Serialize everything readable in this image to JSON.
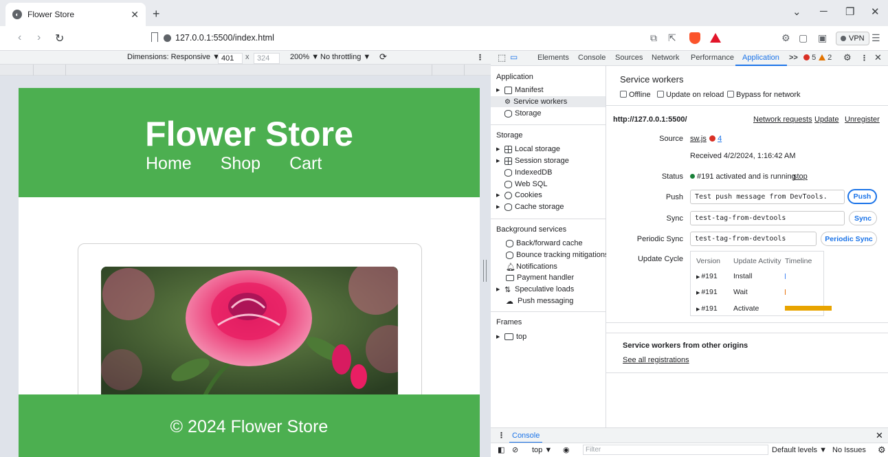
{
  "browser": {
    "tab_title": "Flower Store",
    "url": "127.0.0.1:5500/index.html",
    "vpn_label": "VPN"
  },
  "device_toolbar": {
    "dimensions_label": "Dimensions: Responsive ▼",
    "width": "401",
    "times": "x",
    "height": "324",
    "zoom": "200% ▼",
    "throttling": "No throttling ▼"
  },
  "site": {
    "title": "Flower Store",
    "nav": [
      "Home",
      "Shop",
      "Cart"
    ],
    "footer": "© 2024 Flower Store",
    "brand_color": "#4caf50"
  },
  "devtools": {
    "tabs": [
      "Elements",
      "Console",
      "Sources",
      "Network",
      "Performance",
      "Application",
      ">>"
    ],
    "active_tab": "Application",
    "error_count": "5",
    "warning_count": "2",
    "sidebar": {
      "application_header": "Application",
      "application_items": [
        "Manifest",
        "Service workers",
        "Storage"
      ],
      "storage_header": "Storage",
      "storage_items": [
        "Local storage",
        "Session storage",
        "IndexedDB",
        "Web SQL",
        "Cookies",
        "Cache storage"
      ],
      "background_header": "Background services",
      "background_items": [
        "Back/forward cache",
        "Bounce tracking mitigations",
        "Notifications",
        "Payment handler",
        "Speculative loads",
        "Push messaging"
      ],
      "frames_header": "Frames",
      "frames_items": [
        "top"
      ]
    },
    "service_workers": {
      "heading": "Service workers",
      "options": [
        "Offline",
        "Update on reload",
        "Bypass for network"
      ],
      "origin": "http://127.0.0.1:5500/",
      "links": [
        "Network requests",
        "Update",
        "Unregister"
      ],
      "source_label": "Source",
      "source_file": "sw.js",
      "source_errors": "4",
      "received": "Received 4/2/2024, 1:16:42 AM",
      "status_label": "Status",
      "status_text": "#191 activated and is running",
      "status_stop": "stop",
      "push_label": "Push",
      "push_value": "Test push message from DevTools.",
      "push_button": "Push",
      "sync_label": "Sync",
      "sync_value": "test-tag-from-devtools",
      "sync_button": "Sync",
      "periodic_label": "Periodic Sync",
      "periodic_value": "test-tag-from-devtools",
      "periodic_button": "Periodic Sync",
      "update_cycle_label": "Update Cycle",
      "update_cycle_headers": [
        "Version",
        "Update Activity",
        "Timeline"
      ],
      "update_cycle_rows": [
        {
          "version": "#191",
          "activity": "Install"
        },
        {
          "version": "#191",
          "activity": "Wait"
        },
        {
          "version": "#191",
          "activity": "Activate"
        }
      ],
      "other_origins_heading": "Service workers from other origins",
      "see_all": "See all registrations"
    },
    "console": {
      "tab_label": "Console",
      "context": "top ▼",
      "filter_placeholder": "Filter",
      "levels": "Default levels ▼",
      "issues": "No Issues"
    }
  }
}
